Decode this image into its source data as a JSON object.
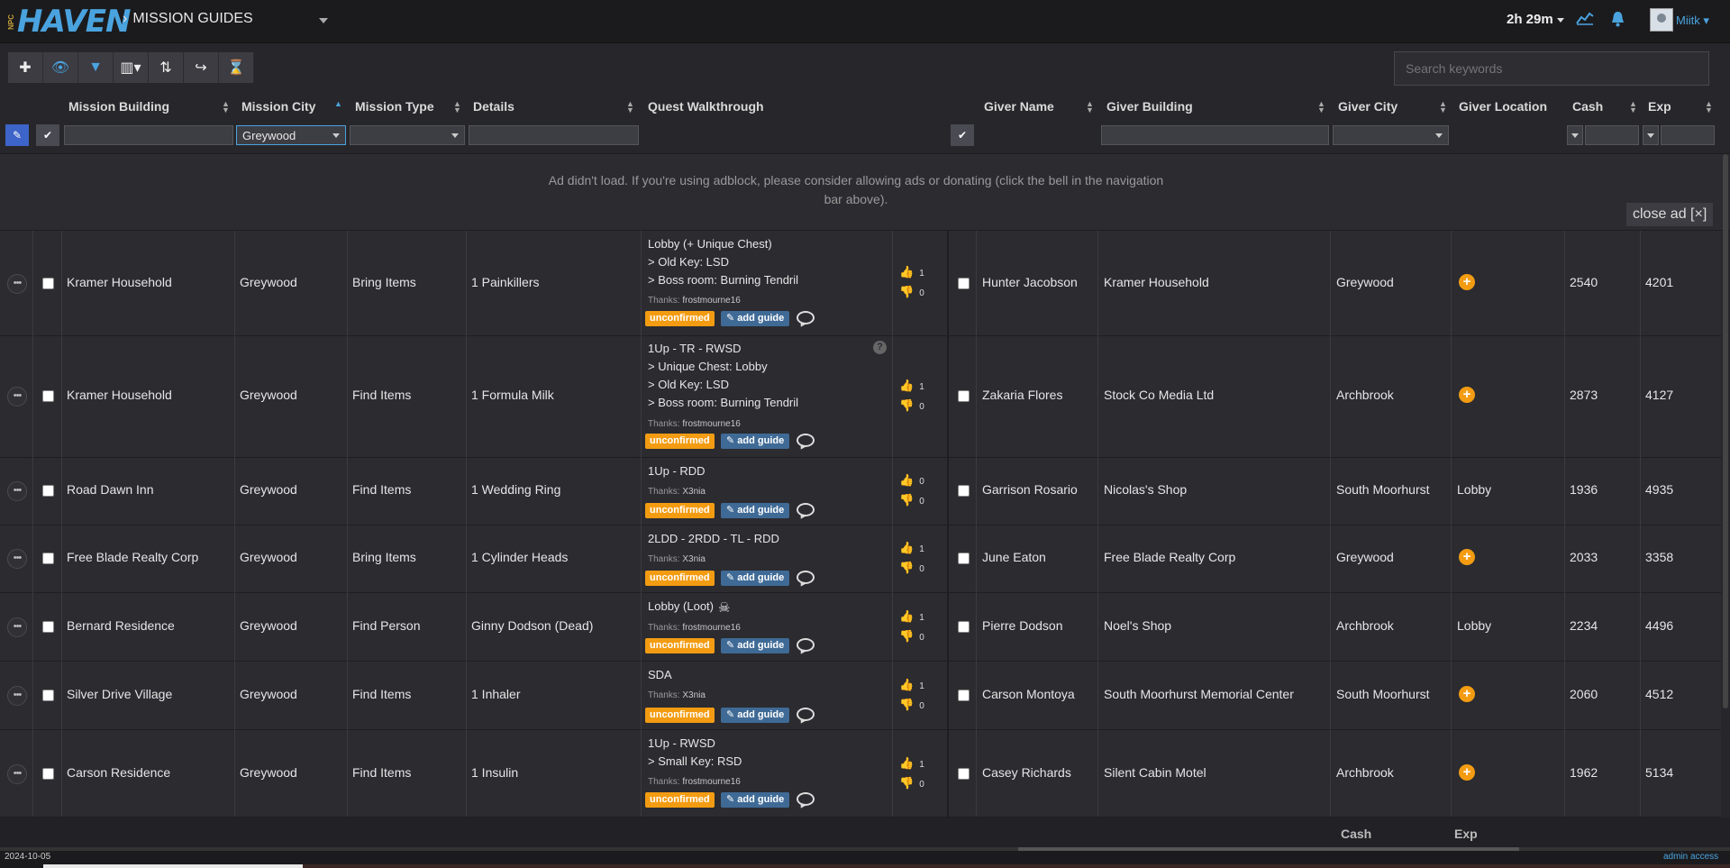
{
  "nav": {
    "logo": "HAVEN",
    "logo_prefix": "NPC",
    "breadcrumb": "MISSION GUIDES",
    "timer": "2h 29m",
    "user": "Miitk"
  },
  "search": {
    "placeholder": "Search keywords"
  },
  "columns": {
    "mission_building": "Mission Building",
    "mission_city": "Mission City",
    "mission_type": "Mission Type",
    "details": "Details",
    "quest_walkthrough": "Quest Walkthrough",
    "giver_name": "Giver Name",
    "giver_building": "Giver Building",
    "giver_city": "Giver City",
    "giver_location": "Giver Location",
    "cash": "Cash",
    "exp": "Exp"
  },
  "filters": {
    "mission_city_value": "Greywood"
  },
  "ad": {
    "message": "Ad didn't load. If you're using adblock, please consider allowing ads or donating (click the bell in the navigation bar above).",
    "close": "close ad [×]"
  },
  "labels": {
    "unconfirmed": "unconfirmed",
    "add_guide": "add guide",
    "thanks": "Thanks:"
  },
  "rows": [
    {
      "building": "Kramer Household",
      "city": "Greywood",
      "type": "Bring Items",
      "details": "1 Painkillers",
      "walk": [
        "Lobby (+ Unique Chest)",
        "> Old Key: LSD",
        "> Boss room: Burning Tendril"
      ],
      "thanks": "frostmourne16",
      "up": "1",
      "down": "0",
      "giver": "Hunter Jacobson",
      "giver_building": "Kramer Household",
      "giver_city": "Greywood",
      "location": "",
      "cash": "2540",
      "exp": "4201"
    },
    {
      "building": "Kramer Household",
      "city": "Greywood",
      "type": "Find Items",
      "details": "1 Formula Milk",
      "walk": [
        "1Up - TR - RWSD",
        "> Unique Chest: Lobby",
        "> Old Key: LSD",
        "> Boss room: Burning Tendril"
      ],
      "thanks": "frostmourne16",
      "up": "1",
      "down": "0",
      "giver": "Zakaria Flores",
      "giver_building": "Stock Co Media Ltd",
      "giver_city": "Archbrook",
      "location": "",
      "cash": "2873",
      "exp": "4127"
    },
    {
      "building": "Road Dawn Inn",
      "city": "Greywood",
      "type": "Find Items",
      "details": "1 Wedding Ring",
      "walk": [
        "1Up - RDD"
      ],
      "thanks": "X3nia",
      "up": "0",
      "down": "0",
      "giver": "Garrison Rosario",
      "giver_building": "Nicolas's Shop",
      "giver_city": "South Moorhurst",
      "location": "Lobby",
      "cash": "1936",
      "exp": "4935"
    },
    {
      "building": "Free Blade Realty Corp",
      "city": "Greywood",
      "type": "Bring Items",
      "details": "1 Cylinder Heads",
      "walk": [
        "2LDD - 2RDD - TL - RDD"
      ],
      "thanks": "X3nia",
      "up": "1",
      "down": "0",
      "giver": "June Eaton",
      "giver_building": "Free Blade Realty Corp",
      "giver_city": "Greywood",
      "location": "",
      "cash": "2033",
      "exp": "3358"
    },
    {
      "building": "Bernard Residence",
      "city": "Greywood",
      "type": "Find Person",
      "details": "Ginny Dodson (Dead)",
      "walk": [
        "Lobby (Loot)"
      ],
      "thanks": "frostmourne16",
      "up": "1",
      "down": "0",
      "giver": "Pierre Dodson",
      "giver_building": "Noel's Shop",
      "giver_city": "Archbrook",
      "location": "Lobby",
      "cash": "2234",
      "exp": "4496"
    },
    {
      "building": "Silver Drive Village",
      "city": "Greywood",
      "type": "Find Items",
      "details": "1 Inhaler",
      "walk": [
        "SDA"
      ],
      "thanks": "X3nia",
      "up": "1",
      "down": "0",
      "giver": "Carson Montoya",
      "giver_building": "South Moorhurst Memorial Center",
      "giver_city": "South Moorhurst",
      "location": "",
      "cash": "2060",
      "exp": "4512"
    },
    {
      "building": "Carson Residence",
      "city": "Greywood",
      "type": "Find Items",
      "details": "1 Insulin",
      "walk": [
        "1Up - RWSD",
        "> Small Key: RSD"
      ],
      "thanks": "frostmourne16",
      "up": "1",
      "down": "0",
      "giver": "Casey Richards",
      "giver_building": "Silent Cabin Motel",
      "giver_city": "Archbrook",
      "location": "",
      "cash": "1962",
      "exp": "5134"
    }
  ],
  "footer": {
    "cash": "Cash",
    "exp": "Exp",
    "date": "2024-10-05",
    "admin": "admin access"
  },
  "colors": {
    "accent": "#4aa3df",
    "unconfirmed": "#f39c12",
    "add_guide": "#3f6a96"
  }
}
